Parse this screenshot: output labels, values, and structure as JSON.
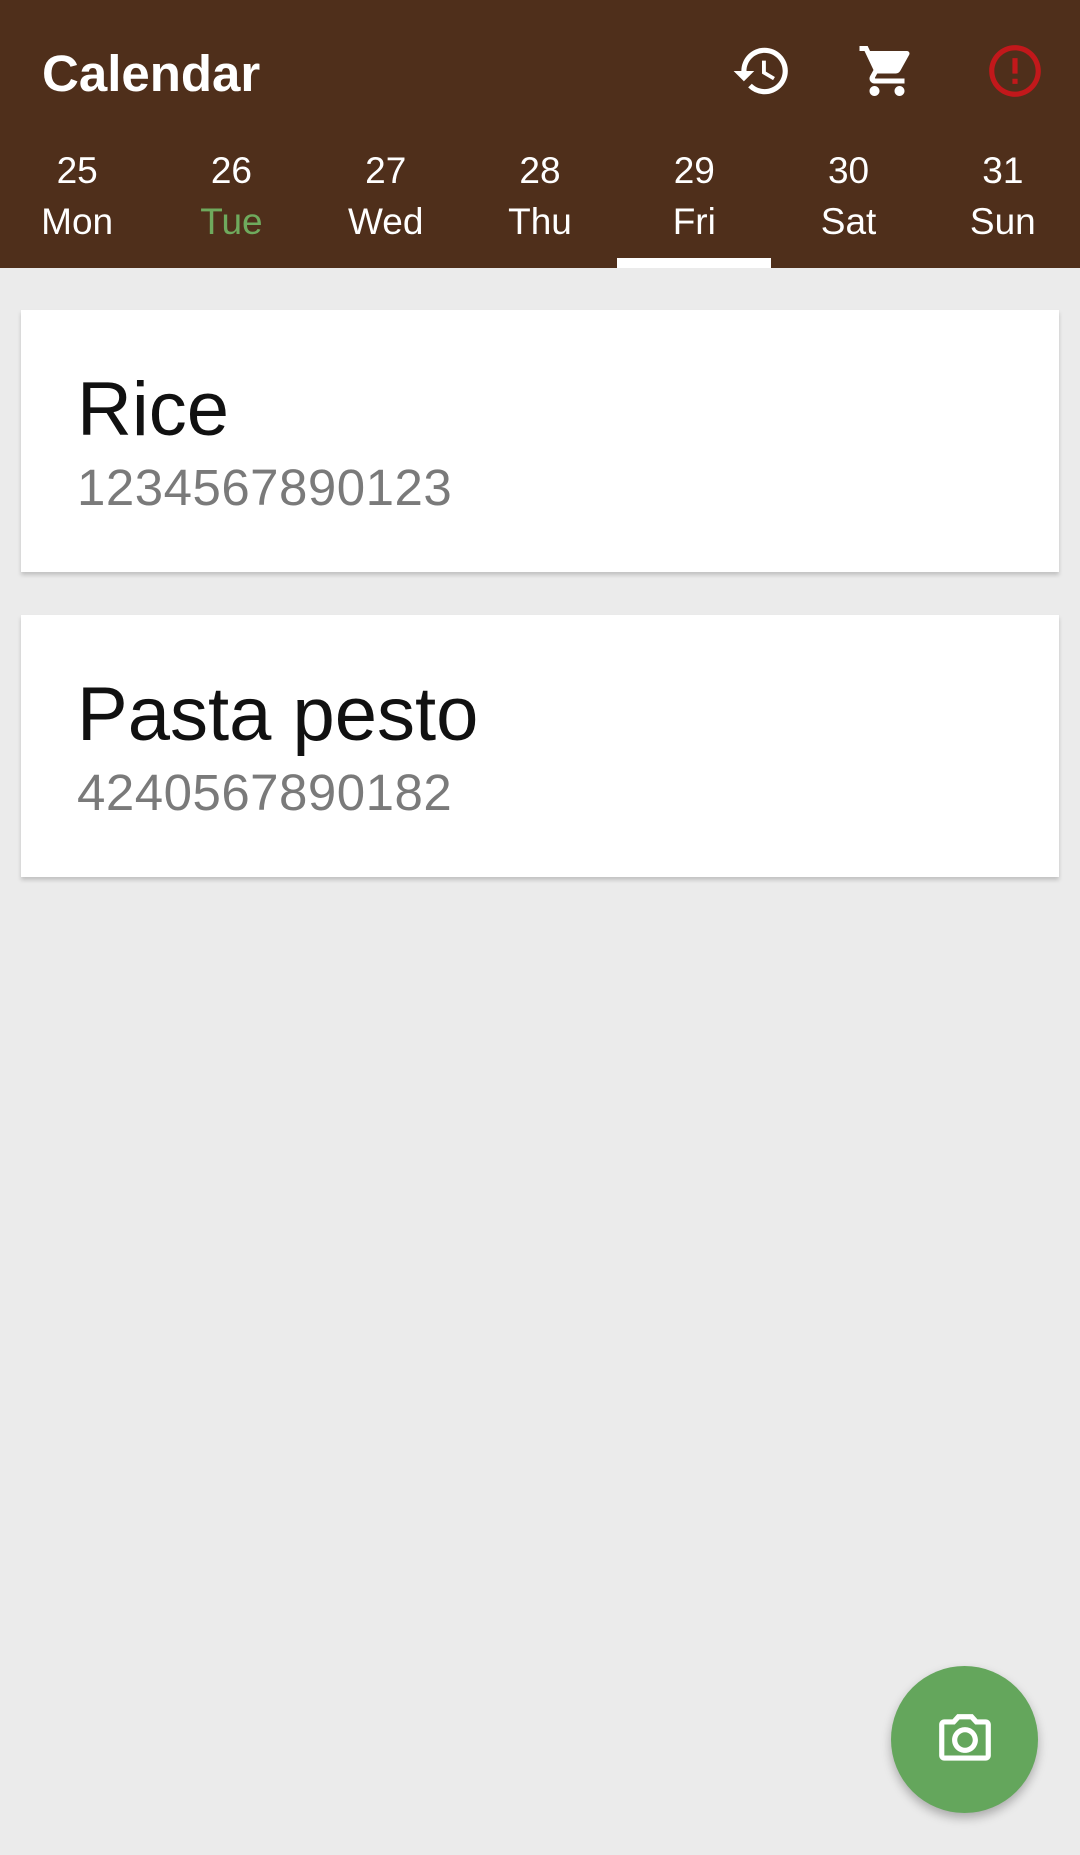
{
  "app_bar": {
    "title": "Calendar",
    "actions": [
      {
        "icon": "history-icon",
        "color": "#ffffff"
      },
      {
        "icon": "shopping-cart-icon",
        "color": "#ffffff"
      },
      {
        "icon": "error-alert-icon",
        "color": "#c2181b"
      }
    ]
  },
  "colors": {
    "app_bar_background": "#4f2f1b",
    "today_accent": "#6faa5d",
    "fab_background": "#64a65c",
    "page_background": "#ebebeb"
  },
  "days": [
    {
      "date": "25",
      "weekday": "Mon"
    },
    {
      "date": "26",
      "weekday": "Tue",
      "today": true
    },
    {
      "date": "27",
      "weekday": "Wed"
    },
    {
      "date": "28",
      "weekday": "Thu"
    },
    {
      "date": "29",
      "weekday": "Fri",
      "selected": true
    },
    {
      "date": "30",
      "weekday": "Sat"
    },
    {
      "date": "31",
      "weekday": "Sun"
    }
  ],
  "items": [
    {
      "name": "Rice",
      "barcode": "1234567890123"
    },
    {
      "name": "Pasta pesto",
      "barcode": "4240567890182"
    }
  ],
  "fab": {
    "icon": "camera-icon"
  }
}
